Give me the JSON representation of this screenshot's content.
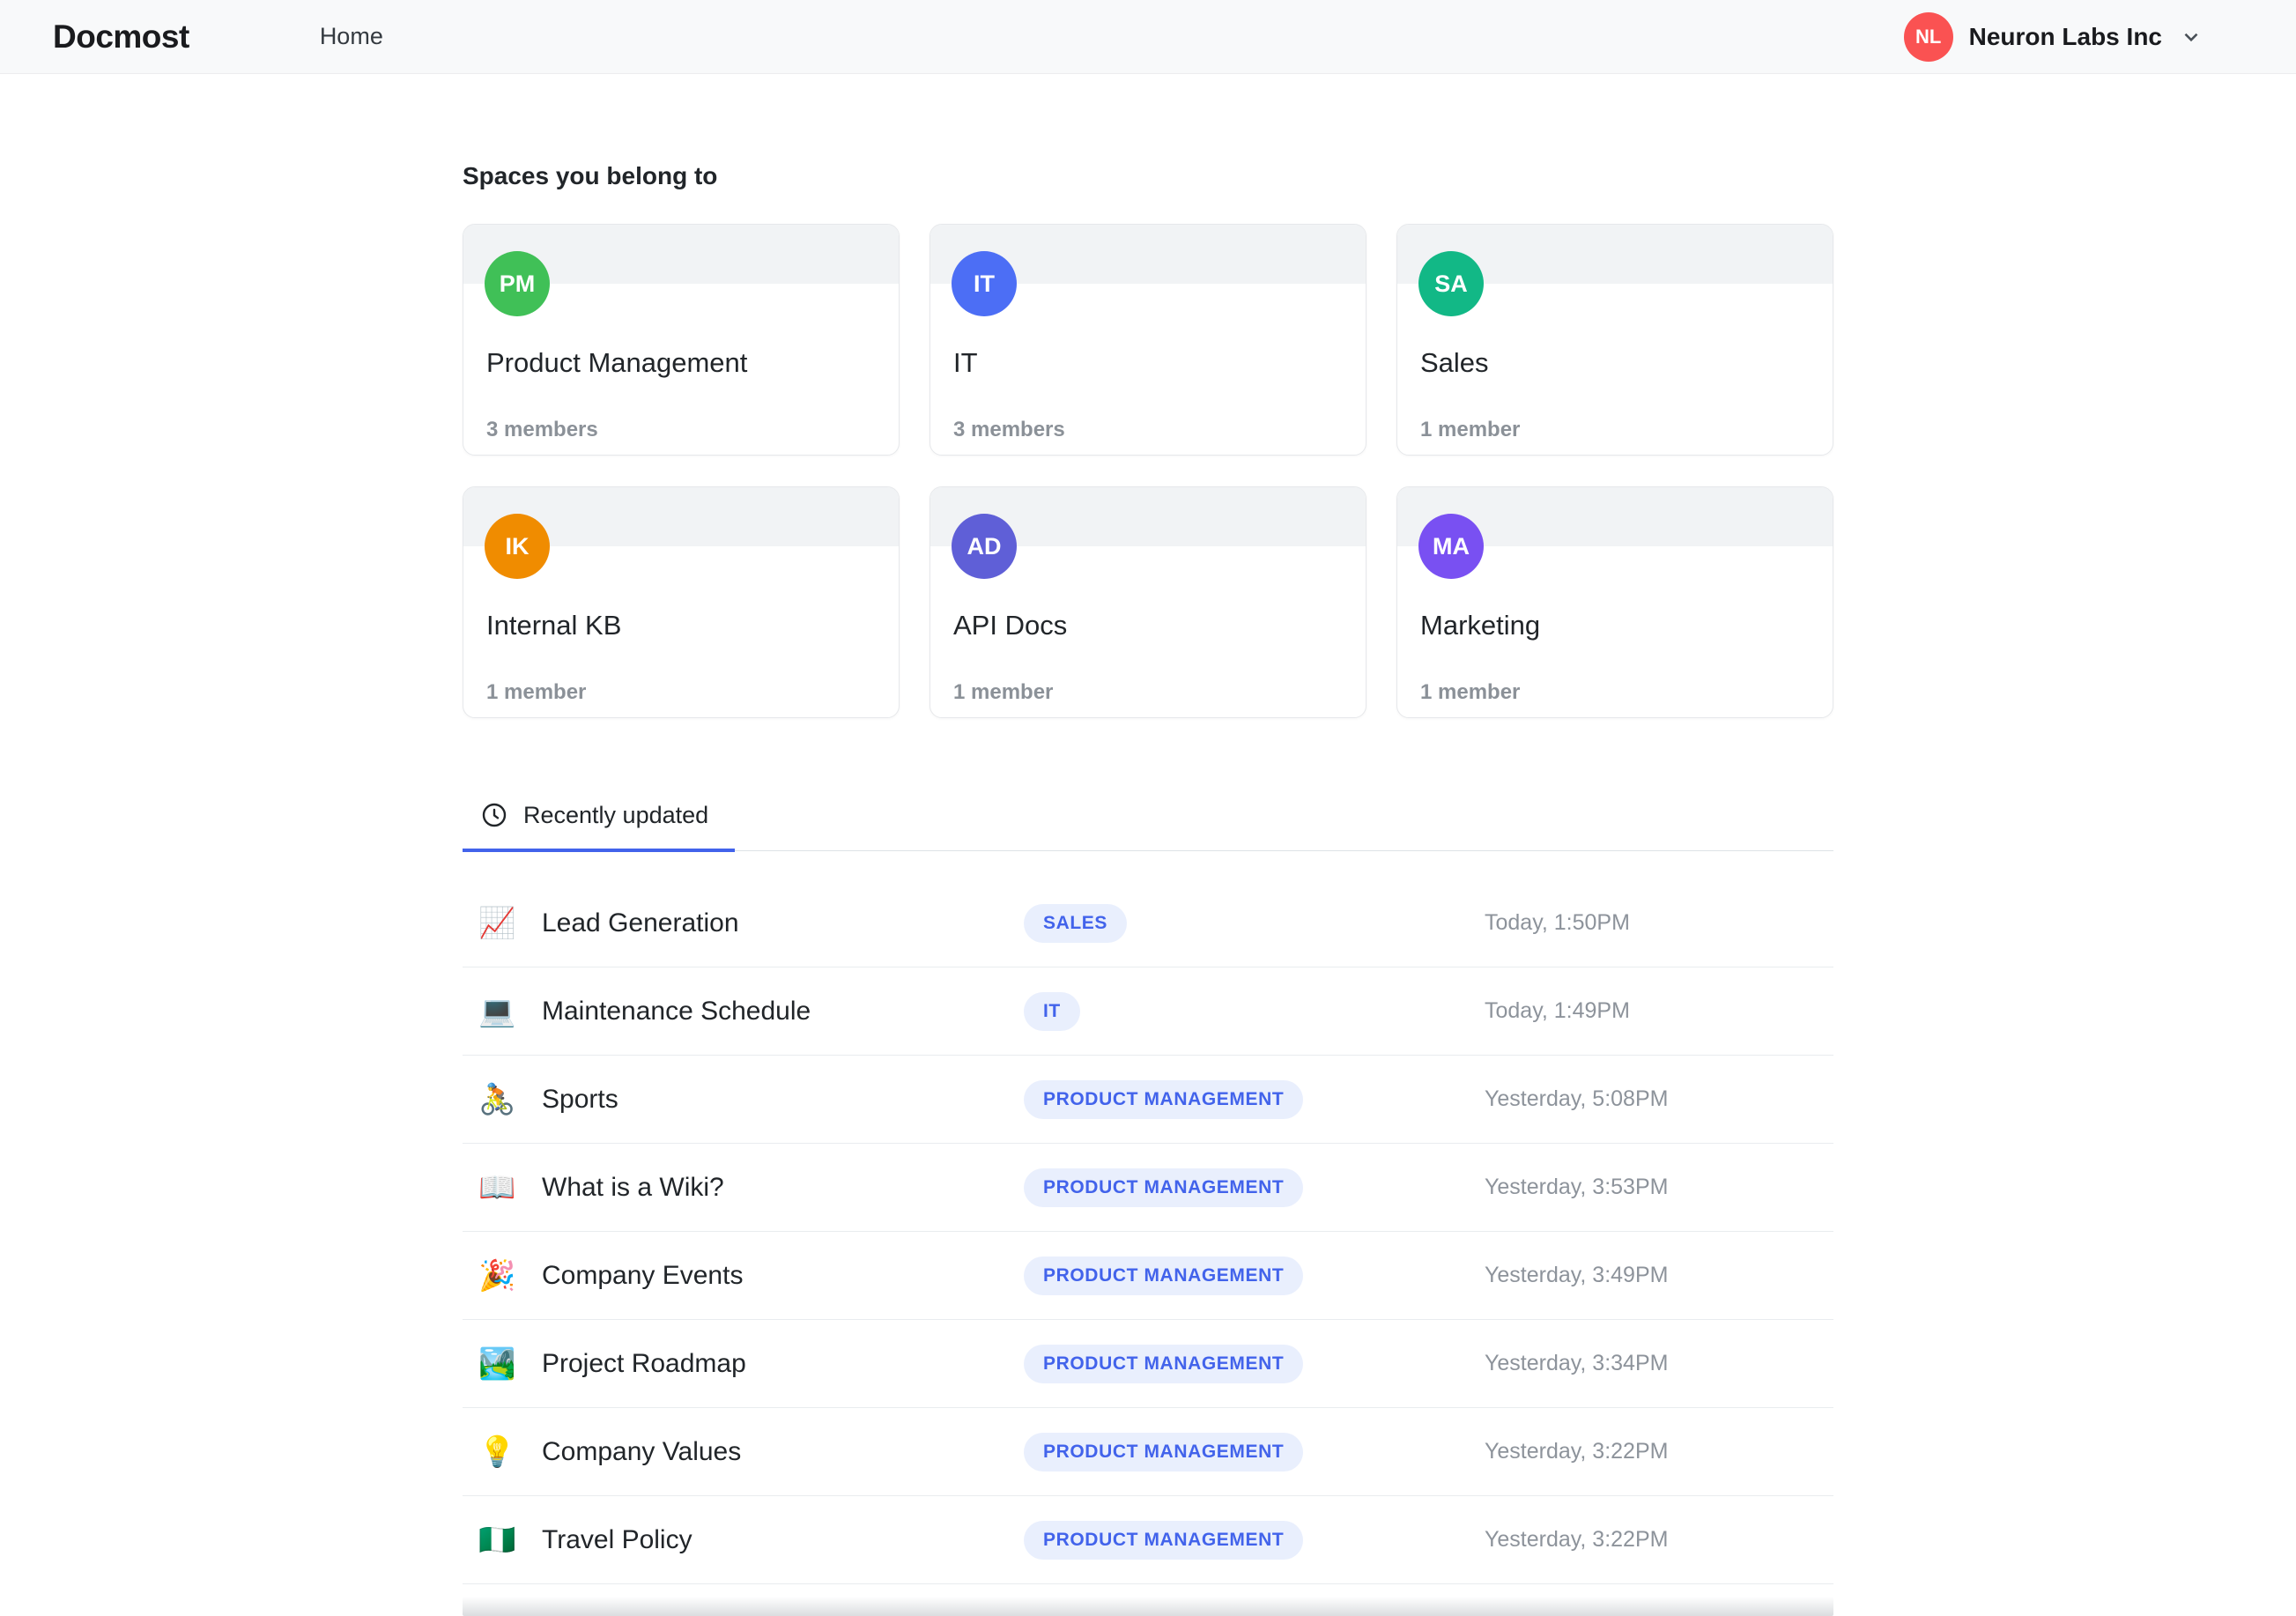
{
  "header": {
    "logo": "Docmost",
    "nav_home": "Home",
    "workspace": {
      "initials": "NL",
      "name": "Neuron Labs Inc",
      "color": "#fa5252"
    }
  },
  "spaces": {
    "heading": "Spaces you belong to",
    "cards": [
      {
        "initials": "PM",
        "name": "Product Management",
        "members": "3 members",
        "color": "#40c057"
      },
      {
        "initials": "IT",
        "name": "IT",
        "members": "3 members",
        "color": "#4c6ef5"
      },
      {
        "initials": "SA",
        "name": "Sales",
        "members": "1 member",
        "color": "#12b886"
      },
      {
        "initials": "IK",
        "name": "Internal KB",
        "members": "1 member",
        "color": "#f08c00"
      },
      {
        "initials": "AD",
        "name": "API Docs",
        "members": "1 member",
        "color": "#5f5fd7"
      },
      {
        "initials": "MA",
        "name": "Marketing",
        "members": "1 member",
        "color": "#7950f2"
      }
    ]
  },
  "tabs": {
    "recently_updated": "Recently updated"
  },
  "pages": [
    {
      "emoji": "📈",
      "title": "Lead Generation",
      "space": "SALES",
      "updated": "Today, 1:50PM"
    },
    {
      "emoji": "💻",
      "title": "Maintenance Schedule",
      "space": "IT",
      "updated": "Today, 1:49PM"
    },
    {
      "emoji": "🚴",
      "title": "Sports",
      "space": "PRODUCT MANAGEMENT",
      "updated": "Yesterday, 5:08PM"
    },
    {
      "emoji": "📖",
      "title": "What is a Wiki?",
      "space": "PRODUCT MANAGEMENT",
      "updated": "Yesterday, 3:53PM"
    },
    {
      "emoji": "🎉",
      "title": "Company Events",
      "space": "PRODUCT MANAGEMENT",
      "updated": "Yesterday, 3:49PM"
    },
    {
      "emoji": "🏞️",
      "title": "Project Roadmap",
      "space": "PRODUCT MANAGEMENT",
      "updated": "Yesterday, 3:34PM"
    },
    {
      "emoji": "💡",
      "title": "Company Values",
      "space": "PRODUCT MANAGEMENT",
      "updated": "Yesterday, 3:22PM"
    },
    {
      "emoji": "🇳🇬",
      "title": "Travel Policy",
      "space": "PRODUCT MANAGEMENT",
      "updated": "Yesterday, 3:22PM"
    }
  ],
  "colors": {
    "accent": "#4263eb",
    "badge_bg": "#e9effd",
    "badge_text": "#4263eb",
    "header_bg": "#f8f9fa"
  }
}
